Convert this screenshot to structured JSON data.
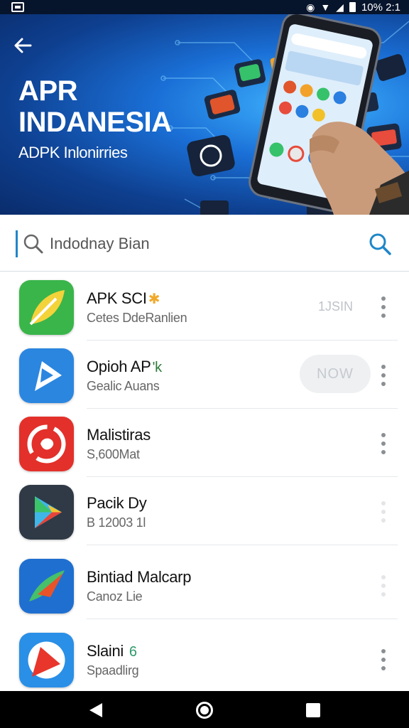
{
  "status_bar": {
    "time_battery": "10% 2:1"
  },
  "banner": {
    "title": "APR INDANESIA",
    "subtitle": "ADPK Inlonirries"
  },
  "search": {
    "value": "Indodnay Bian"
  },
  "apps": [
    {
      "name": "APK SCI",
      "subtitle": "Cetes DdeRanlien",
      "meta": "1JSIN",
      "badge": "✱"
    },
    {
      "name": "Opioh AP",
      "subtitle": "Gealic Auans",
      "action_label": "NOW",
      "badge": "'k"
    },
    {
      "name": "Malistiras",
      "subtitle": "S,600Mat"
    },
    {
      "name": "Pacik Dy",
      "subtitle": "B 12003 1l"
    },
    {
      "name": "Bintiad Malcarp",
      "subtitle": "Canoz Lie"
    },
    {
      "name": "Slaini",
      "subtitle": "Spaadlirg",
      "badge": "6"
    }
  ],
  "colors": {
    "accent": "#1f86c8",
    "banner_dark": "#0a2c6b",
    "banner_light": "#3fb4ff"
  }
}
